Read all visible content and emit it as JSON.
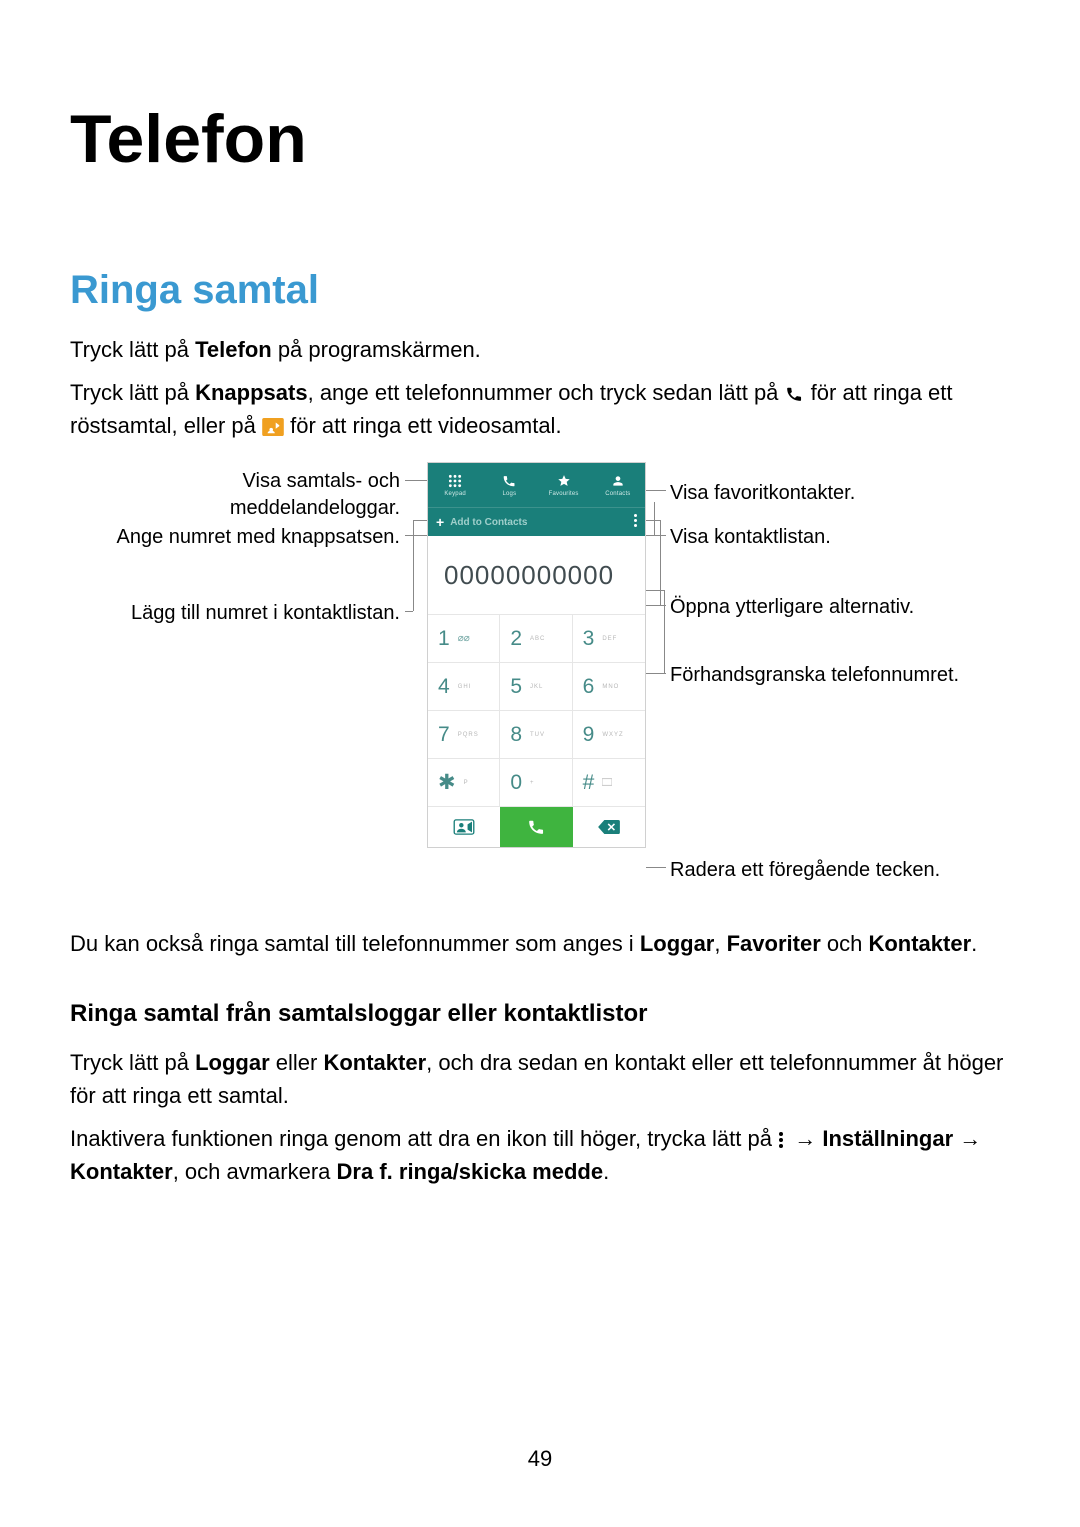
{
  "page_number": "49",
  "h1": "Telefon",
  "h2": "Ringa samtal",
  "p1a": "Tryck lätt på ",
  "p1b": "Telefon",
  "p1c": " på programskärmen.",
  "p2a": "Tryck lätt på ",
  "p2b": "Knappsats",
  "p2c": ", ange ett telefonnummer och tryck sedan lätt på ",
  "p2d": " för att ringa ett röstsamtal, eller på ",
  "p2e": " för att ringa ett videosamtal.",
  "p3a": "Du kan också ringa samtal till telefonnummer som anges i ",
  "p3b": "Loggar",
  "p3c": ", ",
  "p3d": "Favoriter",
  "p3e": " och ",
  "p3f": "Kontakter",
  "p3g": ".",
  "h3": "Ringa samtal från samtalsloggar eller kontaktlistor",
  "p4a": "Tryck lätt på ",
  "p4b": "Loggar",
  "p4c": " eller ",
  "p4d": "Kontakter",
  "p4e": ", och dra sedan en kontakt eller ett telefonnummer åt höger för att ringa ett samtal.",
  "p5a": "Inaktivera funktionen ringa genom att dra en ikon till höger, trycka lätt på ",
  "p5b": " → ",
  "p5c": "Inställningar",
  "p5d": " → ",
  "p5e": "Kontakter",
  "p5f": ", och avmarkera ",
  "p5g": "Dra f. ringa/skicka medde",
  "p5h": ".",
  "callouts": {
    "logs": "Visa samtals- och\nmeddelandeloggar.",
    "keypad": "Ange numret med knappsatsen.",
    "add_contact": "Lägg till numret i kontaktlistan.",
    "favourites": "Visa favoritkontakter.",
    "contacts": "Visa kontaktlistan.",
    "more": "Öppna ytterligare alternativ.",
    "preview": "Förhandsgranska telefonnumret.",
    "backspace": "Radera ett föregående tecken."
  },
  "phone": {
    "tabs": {
      "keypad": "Keypad",
      "logs": "Logs",
      "favourites": "Favourites",
      "contacts": "Contacts"
    },
    "add_to_contacts": "Add to Contacts",
    "number": "00000000000",
    "keys": [
      {
        "d": "1",
        "l": "",
        "vm": true
      },
      {
        "d": "2",
        "l": "ABC"
      },
      {
        "d": "3",
        "l": "DEF"
      },
      {
        "d": "4",
        "l": "GHI"
      },
      {
        "d": "5",
        "l": "JKL"
      },
      {
        "d": "6",
        "l": "MNO"
      },
      {
        "d": "7",
        "l": "PQRS"
      },
      {
        "d": "8",
        "l": "TUV"
      },
      {
        "d": "9",
        "l": "WXYZ"
      },
      {
        "d": "✱",
        "l": "P"
      },
      {
        "d": "0",
        "l": "+"
      },
      {
        "d": "#",
        "l": ""
      }
    ]
  }
}
